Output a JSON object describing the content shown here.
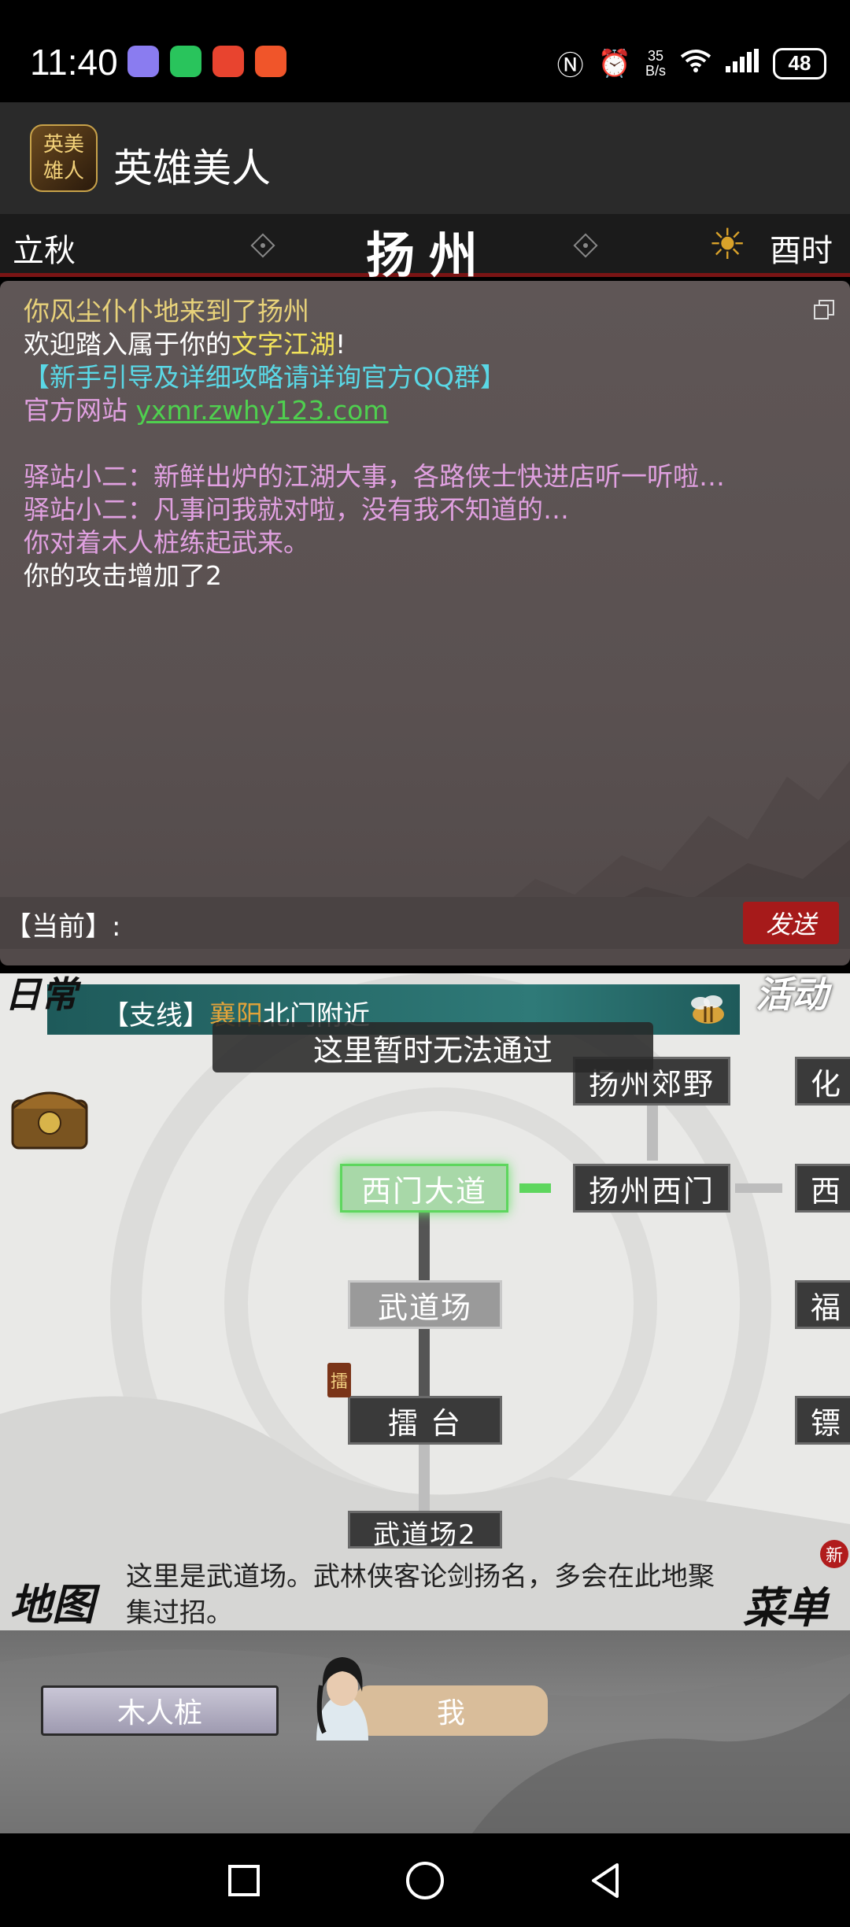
{
  "status_bar": {
    "time": "11:40",
    "network_speed_top": "35",
    "network_speed_bottom": "B/s",
    "battery": "48",
    "app_icon_colors": [
      "#8a7cf0",
      "#29c45c",
      "#e8442f",
      "#f0552a"
    ]
  },
  "app": {
    "logo_text": "英美\n雄人",
    "title": "英雄美人"
  },
  "location": {
    "season": "立秋",
    "city": "扬州",
    "time_of_day": "酉时",
    "sun_icon": "sun-icon"
  },
  "log": {
    "lines": [
      {
        "parts": [
          {
            "text": "你风尘仆仆地来到了",
            "color": "yellow"
          },
          {
            "text": "扬州",
            "color": "yellow"
          }
        ]
      },
      {
        "parts": [
          {
            "text": "欢迎踏入属于你的",
            "color": "white"
          },
          {
            "text": "文字江湖",
            "color": "bright"
          },
          {
            "text": "!",
            "color": "white"
          }
        ]
      },
      {
        "parts": [
          {
            "text": "【新手引导及详细攻略请详询官方QQ群】",
            "color": "cyan"
          }
        ]
      },
      {
        "parts": [
          {
            "text": "官方网站 ",
            "color": "pink"
          },
          {
            "text": "yxmr.zwhy123.com",
            "color": "green"
          }
        ]
      },
      {
        "parts": [
          {
            "text": " ",
            "color": "white"
          }
        ]
      },
      {
        "parts": [
          {
            "text": "驿站小二：新鲜出炉的江湖大事，各路侠士快进店听一听啦…",
            "color": "pink"
          }
        ]
      },
      {
        "parts": [
          {
            "text": "驿站小二：凡事问我就对啦，没有我不知道的…",
            "color": "pink"
          }
        ]
      },
      {
        "parts": [
          {
            "text": "你对着木人桩练起武来。",
            "color": "pink"
          }
        ]
      },
      {
        "parts": [
          {
            "text": "你的攻击增加了2",
            "color": "white"
          }
        ]
      }
    ],
    "input_label": "【当前】:",
    "input_value": "",
    "send_label": "发送"
  },
  "map": {
    "daily_badge": "日常",
    "event_badge": "活动",
    "quest_prefix": "【支线】",
    "quest_place": "襄阳",
    "quest_rest": "北门附近",
    "toast": "这里暂时无法通过",
    "nodes": {
      "top": "扬州郊野",
      "top_right": "化",
      "west_road": "西门大道",
      "west_gate": "扬州西门",
      "right_mid": "西",
      "dojo": "武道场",
      "right_3": "福",
      "ring": "擂  台",
      "right_4": "镖",
      "dojo2": "武道场2"
    },
    "ring_tag": "擂",
    "map_label": "地图",
    "description": "这里是武道场。武林侠客论剑扬名，多会在此地聚集过招。",
    "menu_label": "菜单",
    "new_badge": "新"
  },
  "characters": {
    "npc": "木人桩",
    "player": "我"
  },
  "navbar": {
    "icons": [
      "recent-apps-icon",
      "home-icon",
      "back-icon"
    ]
  }
}
